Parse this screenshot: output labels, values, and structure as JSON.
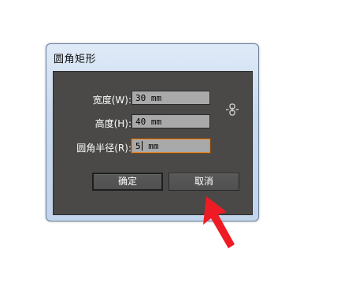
{
  "dialog": {
    "title": "圆角矩形",
    "fields": [
      {
        "label": "宽度(W):",
        "value": "30 mm"
      },
      {
        "label": "高度(H):",
        "value": "40 mm"
      },
      {
        "label": "圆角半径(R):",
        "value_before_caret": "5",
        "value_after_caret": " mm"
      }
    ],
    "link_icon": "chain-link-icon",
    "ok_label": "确定",
    "cancel_label": "取消"
  },
  "annotation": {
    "arrow_icon": "red-arrow-icon",
    "arrow_color": "#ee1b24"
  },
  "colors": {
    "panel_bg": "#4a4948",
    "input_bg": "#a9a9a9",
    "focus_border": "#e0862f"
  }
}
